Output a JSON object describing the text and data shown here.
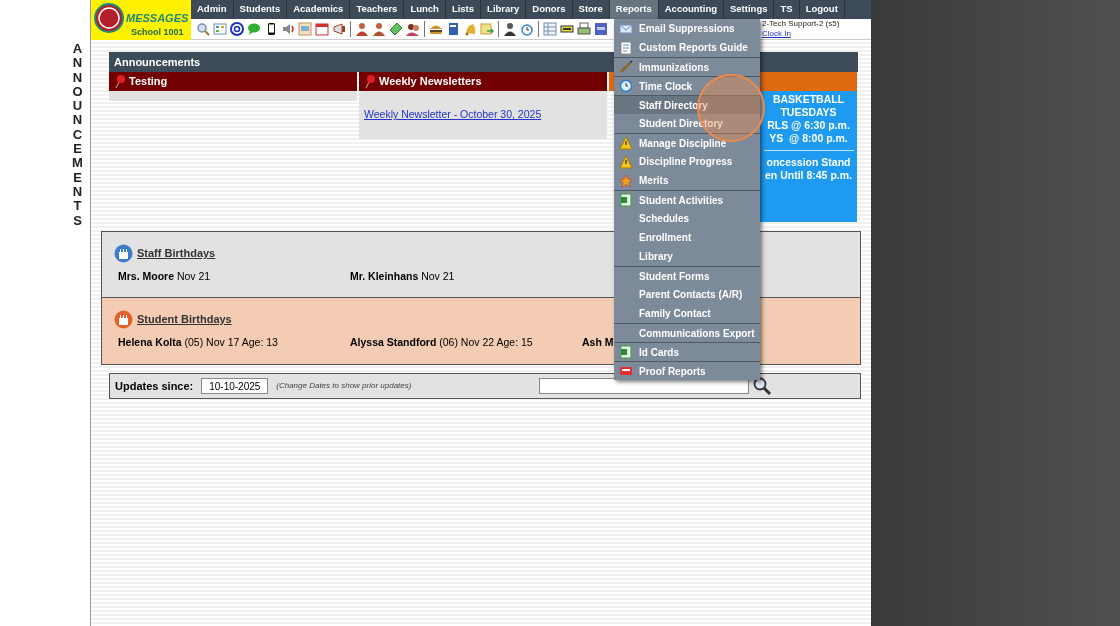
{
  "logo": {
    "title": "MESSAGES",
    "school": "School 1001"
  },
  "nav": [
    {
      "label": "Admin",
      "selected": false
    },
    {
      "label": "Students",
      "selected": false
    },
    {
      "label": "Academics",
      "selected": false
    },
    {
      "label": "Teachers",
      "selected": false
    },
    {
      "label": "Lunch",
      "selected": false
    },
    {
      "label": "Lists",
      "selected": false
    },
    {
      "label": "Library",
      "selected": false
    },
    {
      "label": "Donors",
      "selected": false
    },
    {
      "label": "Store",
      "selected": false
    },
    {
      "label": "Reports",
      "selected": true
    },
    {
      "label": "Accounting",
      "selected": false
    },
    {
      "label": "Settings",
      "selected": false
    },
    {
      "label": "TS",
      "selected": false
    },
    {
      "label": "Logout",
      "selected": false
    }
  ],
  "user": {
    "name": "2-Tech Support-2 (s5)",
    "clock_link": "Clock In"
  },
  "side_label": "ANNOUNCEMENTS",
  "announcements": {
    "title": "Announcements",
    "columns": [
      {
        "title": "Testing",
        "kind": "plain"
      },
      {
        "title": "Weekly Newsletters",
        "kind": "links",
        "links": [
          "Weekly Newsletter - October 30, 2025"
        ]
      },
      {
        "kind": "poster",
        "lines": [
          "BASKETBALL",
          "TUESDAYS",
          "RLS @ 6:30 p.m.",
          "YS  @ 8:00 p.m.",
          "oncession Stand",
          "en Until 8:45 p.m."
        ]
      }
    ]
  },
  "staff_birthdays": {
    "title": "Staff Birthdays",
    "people": [
      {
        "name": "Mrs. Moore",
        "detail": "Nov 21"
      },
      {
        "name": "Mr. Kleinhans",
        "detail": "Nov 21"
      }
    ]
  },
  "student_birthdays": {
    "title": "Student Birthdays",
    "people": [
      {
        "name": "Helena Kolta",
        "detail": "(05) Nov 17 Age: 13"
      },
      {
        "name": "Alyssa Standford",
        "detail": "(06) Nov 22 Age: 15"
      },
      {
        "name": "Ash M"
      }
    ]
  },
  "updates": {
    "label": "Updates since:",
    "date": "10-10-2025",
    "hint": "(Change Dates to show prior updates)"
  },
  "menu": {
    "groups": [
      [
        {
          "label": "Email Suppressions",
          "highlighted": false
        },
        {
          "label": "Custom Reports Guide",
          "highlighted": false
        }
      ],
      [
        {
          "label": "Immunizations",
          "highlighted": false
        }
      ],
      [
        {
          "label": "Time Clock",
          "highlighted": false
        }
      ],
      [
        {
          "label": "Staff Directory",
          "highlighted": true
        },
        {
          "label": "Student Directory",
          "highlighted": false
        }
      ],
      [
        {
          "label": "Manage Discipline",
          "highlighted": false
        },
        {
          "label": "Discipline Progress",
          "highlighted": false
        },
        {
          "label": "Merits",
          "highlighted": false
        }
      ],
      [
        {
          "label": "Student Activities",
          "highlighted": false
        },
        {
          "label": "Schedules",
          "highlighted": false
        },
        {
          "label": "Enrollment",
          "highlighted": false
        },
        {
          "label": "Library",
          "highlighted": false
        }
      ],
      [
        {
          "label": "Student Forms",
          "highlighted": false
        },
        {
          "label": "Parent Contacts (A/R)",
          "highlighted": false
        },
        {
          "label": "Family Contact",
          "highlighted": false
        }
      ],
      [
        {
          "label": "Communications Export",
          "highlighted": false
        }
      ],
      [
        {
          "label": "Id Cards",
          "highlighted": false
        }
      ],
      [
        {
          "label": "Proof Reports",
          "highlighted": false
        }
      ]
    ]
  }
}
